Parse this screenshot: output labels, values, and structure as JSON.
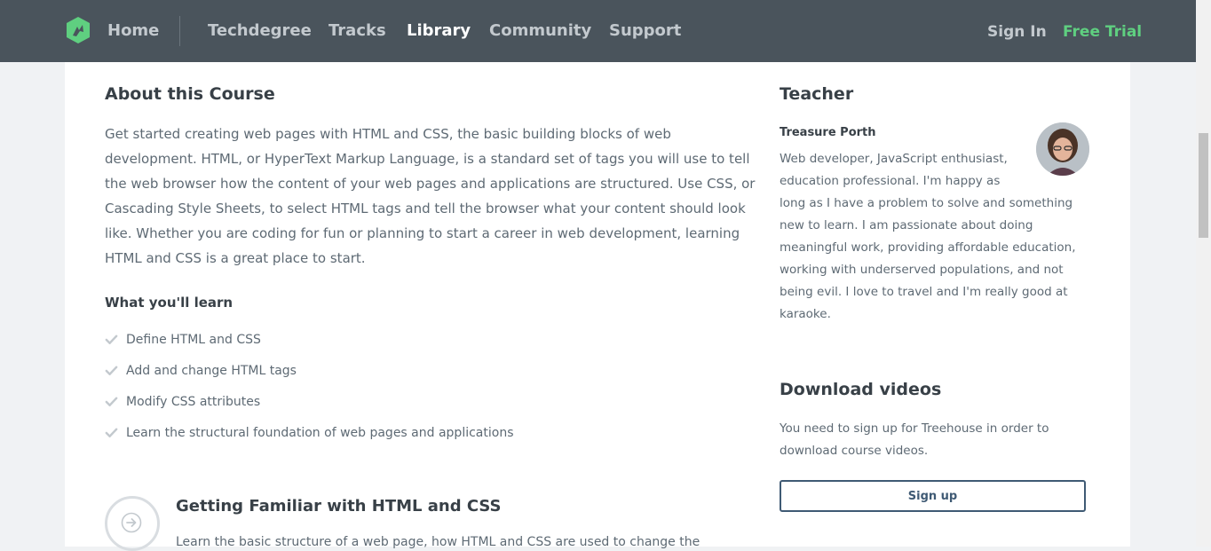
{
  "nav": {
    "home": "Home",
    "links": [
      "Techdegree",
      "Tracks",
      "Library",
      "Community",
      "Support"
    ],
    "active": "Library",
    "sign_in": "Sign In",
    "free_trial": "Free Trial",
    "logo_icon": "treehouse-logo-icon"
  },
  "colors": {
    "nav_bg": "#4a545c",
    "accent_green": "#5fcf80",
    "button_border": "#3f5a74"
  },
  "about": {
    "title": "About this Course",
    "description": "Get started creating web pages with HTML and CSS, the basic building blocks of web development. HTML, or HyperText Markup Language, is a standard set of tags you will use to tell the web browser how the content of your web pages and applications are structured. Use CSS, or Cascading Style Sheets, to select HTML tags and tell the browser what your content should look like. Whether you are coding for fun or planning to start a career in web development, learning HTML and CSS is a great place to start.",
    "learn_title": "What you'll learn",
    "learn_items": [
      "Define HTML and CSS",
      "Add and change HTML tags",
      "Modify CSS attributes",
      "Learn the structural foundation of web pages and applications"
    ]
  },
  "stage": {
    "title": "Getting Familiar with HTML and CSS",
    "description": "Learn the basic structure of a web page, how HTML and CSS are used to change the"
  },
  "teacher": {
    "heading": "Teacher",
    "name": "Treasure Porth",
    "bio_first": "Web developer, JavaScript enthusiast, education professional. I'm happy as",
    "bio_rest": "long as I have a problem to solve and something new to learn. I am passionate about doing meaningful work, providing affordable education, working with underserved populations, and not being evil. I love to travel and I'm really good at karaoke."
  },
  "download": {
    "heading": "Download videos",
    "text": "You need to sign up for Treehouse in order to download course videos.",
    "button": "Sign up"
  }
}
